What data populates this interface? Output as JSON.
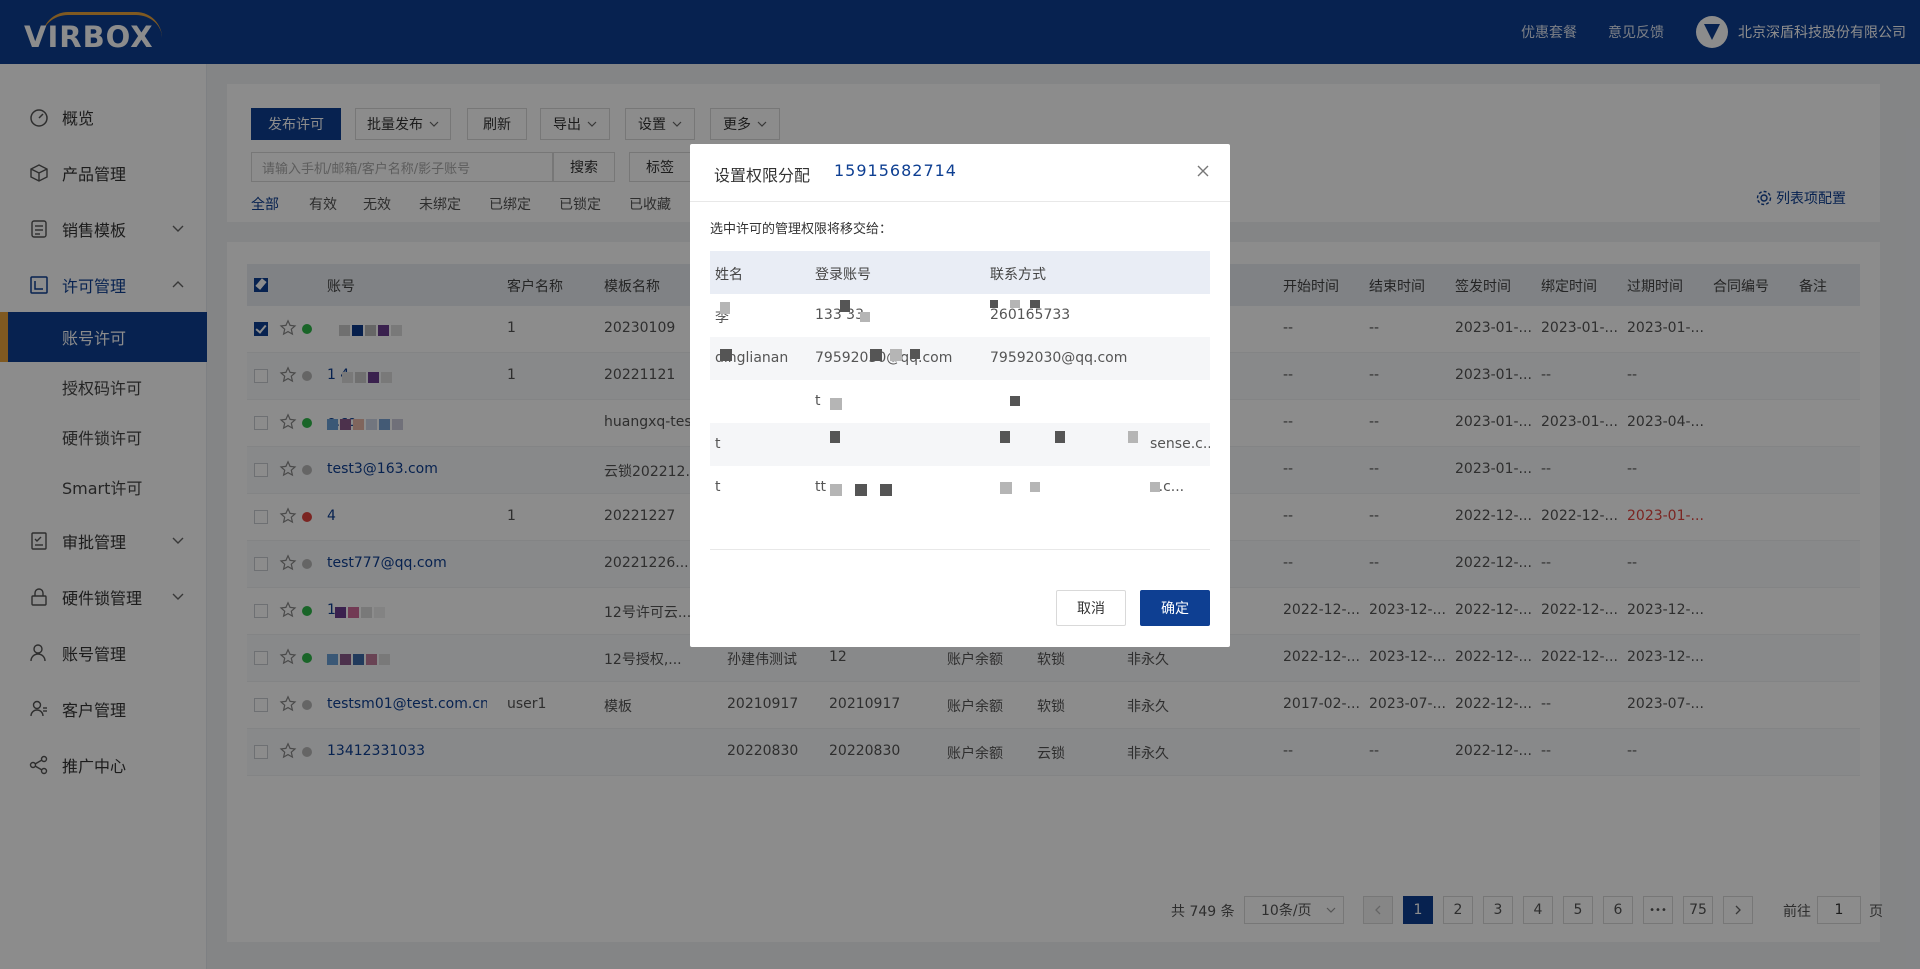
{
  "header": {
    "logo_text": "VIRBOX",
    "links": [
      "优惠套餐",
      "意见反馈"
    ],
    "company": "北京深盾科技股份有限公司",
    "accent": "#e8a33d",
    "brand": "#0e3f92"
  },
  "sidebar": {
    "items": [
      {
        "label": "概览",
        "icon": "dashboard-icon"
      },
      {
        "label": "产品管理",
        "icon": "box-icon"
      },
      {
        "label": "销售模板",
        "icon": "template-icon"
      },
      {
        "label": "许可管理",
        "icon": "license-icon"
      },
      {
        "label": "审批管理",
        "icon": "approval-icon"
      },
      {
        "label": "硬件锁管理",
        "icon": "lock-icon"
      },
      {
        "label": "账号管理",
        "icon": "user-icon"
      },
      {
        "label": "客户管理",
        "icon": "customer-icon"
      },
      {
        "label": "推广中心",
        "icon": "share-icon"
      }
    ],
    "sub_items": [
      "账号许可",
      "授权码许可",
      "硬件锁许可",
      "Smart许可"
    ],
    "active_sub": "账号许可"
  },
  "toolbar": {
    "publish": "发布许可",
    "batch": "批量发布",
    "refresh": "刷新",
    "export": "导出",
    "settings": "设置",
    "more": "更多",
    "search_placeholder": "请输入手机/邮箱/客户名称/影子账号",
    "search_btn": "搜索",
    "tag_btn": "标签",
    "filters": [
      "全部",
      "有效",
      "无效",
      "未绑定",
      "已绑定",
      "已锁定",
      "已收藏"
    ],
    "col_config": "列表项配置"
  },
  "table": {
    "headers": {
      "account": "账号",
      "customer": "客户名称",
      "template": "模板名称",
      "start": "开始时间",
      "end": "结束时间",
      "issued": "签发时间",
      "bound": "绑定时间",
      "expire": "过期时间",
      "contract": "合同编号",
      "remark": "备注"
    },
    "rows": [
      {
        "account": "",
        "customer": "1",
        "template": "20230109",
        "c4": "",
        "c5": "",
        "c6": "",
        "c7": "",
        "start": "--",
        "end": "--",
        "issued": "2023-01-...",
        "bound": "2023-01-...",
        "expire": "2023-01-...",
        "status": "green"
      },
      {
        "account": "1 4",
        "customer": "1",
        "template": "20221121",
        "c4": "",
        "c5": "",
        "c6": "",
        "c7": "",
        "start": "--",
        "end": "--",
        "issued": "2023-01-...",
        "bound": "--",
        "expire": "--",
        "status": "gray"
      },
      {
        "account": "e.co...",
        "customer": "",
        "template": "huangxq-tes",
        "c4": "",
        "c5": "",
        "c6": "",
        "c7": "",
        "start": "--",
        "end": "--",
        "issued": "2023-01-...",
        "bound": "2023-01-...",
        "expire": "2023-04-...",
        "status": "green"
      },
      {
        "account": "test3@163.com",
        "customer": "",
        "template": "云锁202212...",
        "c4": "",
        "c5": "",
        "c6": "",
        "c7": "",
        "start": "--",
        "end": "--",
        "issued": "2023-01-...",
        "bound": "--",
        "expire": "--",
        "status": "gray"
      },
      {
        "account": "4",
        "customer": "1",
        "template": "20221227",
        "c4": "",
        "c5": "",
        "c6": "",
        "c7": "",
        "start": "--",
        "end": "--",
        "issued": "2022-12-...",
        "bound": "2022-12-...",
        "expire": "2023-01-...",
        "status": "red"
      },
      {
        "account": "test777@qq.com",
        "customer": "",
        "template": "20221226...",
        "c4": "",
        "c5": "",
        "c6": "",
        "c7": "",
        "start": "--",
        "end": "--",
        "issued": "2022-12-...",
        "bound": "--",
        "expire": "--",
        "status": "gray"
      },
      {
        "account": "1",
        "customer": "",
        "template": "12号许可云...",
        "c4": "",
        "c5": "",
        "c6": "",
        "c7": "",
        "start": "2022-12-...",
        "end": "2023-12-...",
        "issued": "2022-12-...",
        "bound": "2022-12-...",
        "expire": "2023-12-...",
        "status": "green"
      },
      {
        "account": "",
        "customer": "",
        "template": "12号授权,...",
        "c4": "孙建伟测试",
        "c5": "12",
        "c6": "账户余额",
        "c7": "软锁",
        "c8": "非永久",
        "start": "2022-12-...",
        "end": "2023-12-...",
        "issued": "2022-12-...",
        "bound": "2022-12-...",
        "expire": "2023-12-...",
        "status": "green"
      },
      {
        "account": "testsm01@test.com.cn",
        "customer": "user1",
        "template": "模板",
        "c4": "20210917",
        "c5": "20210917",
        "c6": "账户余额",
        "c7": "软锁",
        "c8": "非永久",
        "start": "2017-02-...",
        "end": "2023-07-...",
        "issued": "2022-12-...",
        "bound": "--",
        "expire": "2023-07-...",
        "status": "gray"
      },
      {
        "account": "13412331033",
        "customer": "",
        "template": "",
        "c4": "20220830",
        "c5": "20220830",
        "c6": "账户余额",
        "c7": "云锁",
        "c8": "非永久",
        "start": "--",
        "end": "--",
        "issued": "2022-12-...",
        "bound": "--",
        "expire": "--",
        "status": "gray"
      }
    ]
  },
  "pagination": {
    "total": "共 749 条",
    "page_size": "10条/页",
    "pages": [
      "1",
      "2",
      "3",
      "4",
      "5",
      "6",
      "•••",
      "75"
    ],
    "goto_label": "前往",
    "goto_value": "1",
    "page_suffix": "页"
  },
  "modal": {
    "title": "设置权限分配",
    "account_id": "15915682714",
    "note": "选中许可的管理权限将移交给：",
    "headers": [
      "姓名",
      "登录账号",
      "联系方式"
    ],
    "rows": [
      {
        "name": "李",
        "login": "133 33",
        "contact": "260165733"
      },
      {
        "name": "dinglianan",
        "login": "79592030@qq.com",
        "contact": "79592030@qq.com"
      },
      {
        "name": "",
        "login": "t",
        "contact": ""
      },
      {
        "name": "t",
        "login": "",
        "contact": "sense.c..."
      },
      {
        "name": "t",
        "login": "tt",
        "contact": "e.c..."
      }
    ],
    "cancel": "取消",
    "ok": "确定"
  }
}
